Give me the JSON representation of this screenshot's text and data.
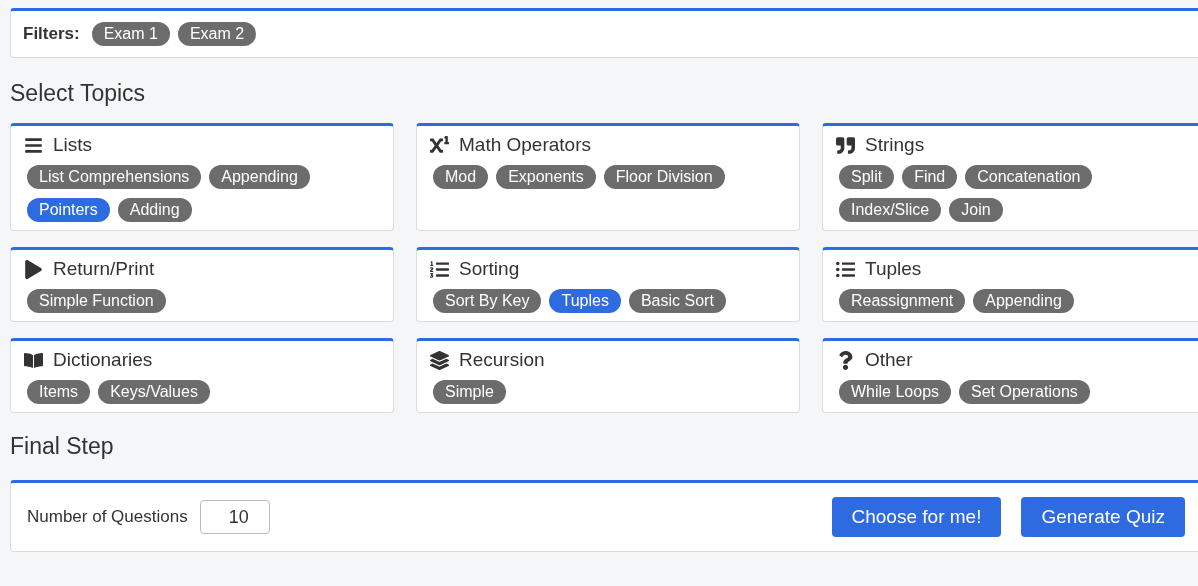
{
  "filters": {
    "label": "Filters:",
    "chips": [
      {
        "label": "Exam 1",
        "selected": false
      },
      {
        "label": "Exam 2",
        "selected": false
      }
    ]
  },
  "topics_heading": "Select Topics",
  "topics": [
    {
      "title": "Lists",
      "kind": "bars",
      "subtopics": [
        {
          "label": "List Comprehensions",
          "selected": false
        },
        {
          "label": "Appending",
          "selected": false
        },
        {
          "label": "Pointers",
          "selected": true
        },
        {
          "label": "Adding",
          "selected": false
        }
      ]
    },
    {
      "title": "Math Operators",
      "kind": "superscript",
      "subtopics": [
        {
          "label": "Mod",
          "selected": false
        },
        {
          "label": "Exponents",
          "selected": false
        },
        {
          "label": "Floor Division",
          "selected": false
        }
      ]
    },
    {
      "title": "Strings",
      "kind": "quote",
      "subtopics": [
        {
          "label": "Split",
          "selected": false
        },
        {
          "label": "Find",
          "selected": false
        },
        {
          "label": "Concatenation",
          "selected": false
        },
        {
          "label": "Index/Slice",
          "selected": false
        },
        {
          "label": "Join",
          "selected": false
        }
      ]
    },
    {
      "title": "Return/Print",
      "kind": "play",
      "subtopics": [
        {
          "label": "Simple Function",
          "selected": false
        }
      ]
    },
    {
      "title": "Sorting",
      "kind": "ordered",
      "subtopics": [
        {
          "label": "Sort By Key",
          "selected": false
        },
        {
          "label": "Tuples",
          "selected": true
        },
        {
          "label": "Basic Sort",
          "selected": false
        }
      ]
    },
    {
      "title": "Tuples",
      "kind": "bulleted",
      "subtopics": [
        {
          "label": "Reassignment",
          "selected": false
        },
        {
          "label": "Appending",
          "selected": false
        }
      ]
    },
    {
      "title": "Dictionaries",
      "kind": "book",
      "subtopics": [
        {
          "label": "Items",
          "selected": false
        },
        {
          "label": "Keys/Values",
          "selected": false
        }
      ]
    },
    {
      "title": "Recursion",
      "kind": "layers",
      "subtopics": [
        {
          "label": "Simple",
          "selected": false
        }
      ]
    },
    {
      "title": "Other",
      "kind": "question",
      "subtopics": [
        {
          "label": "While Loops",
          "selected": false
        },
        {
          "label": "Set Operations",
          "selected": false
        }
      ]
    }
  ],
  "final_heading": "Final Step",
  "final": {
    "questions_label": "Number of Questions",
    "questions_value": "10",
    "buttons": [
      "Choose for me!",
      "Generate Quiz"
    ]
  }
}
